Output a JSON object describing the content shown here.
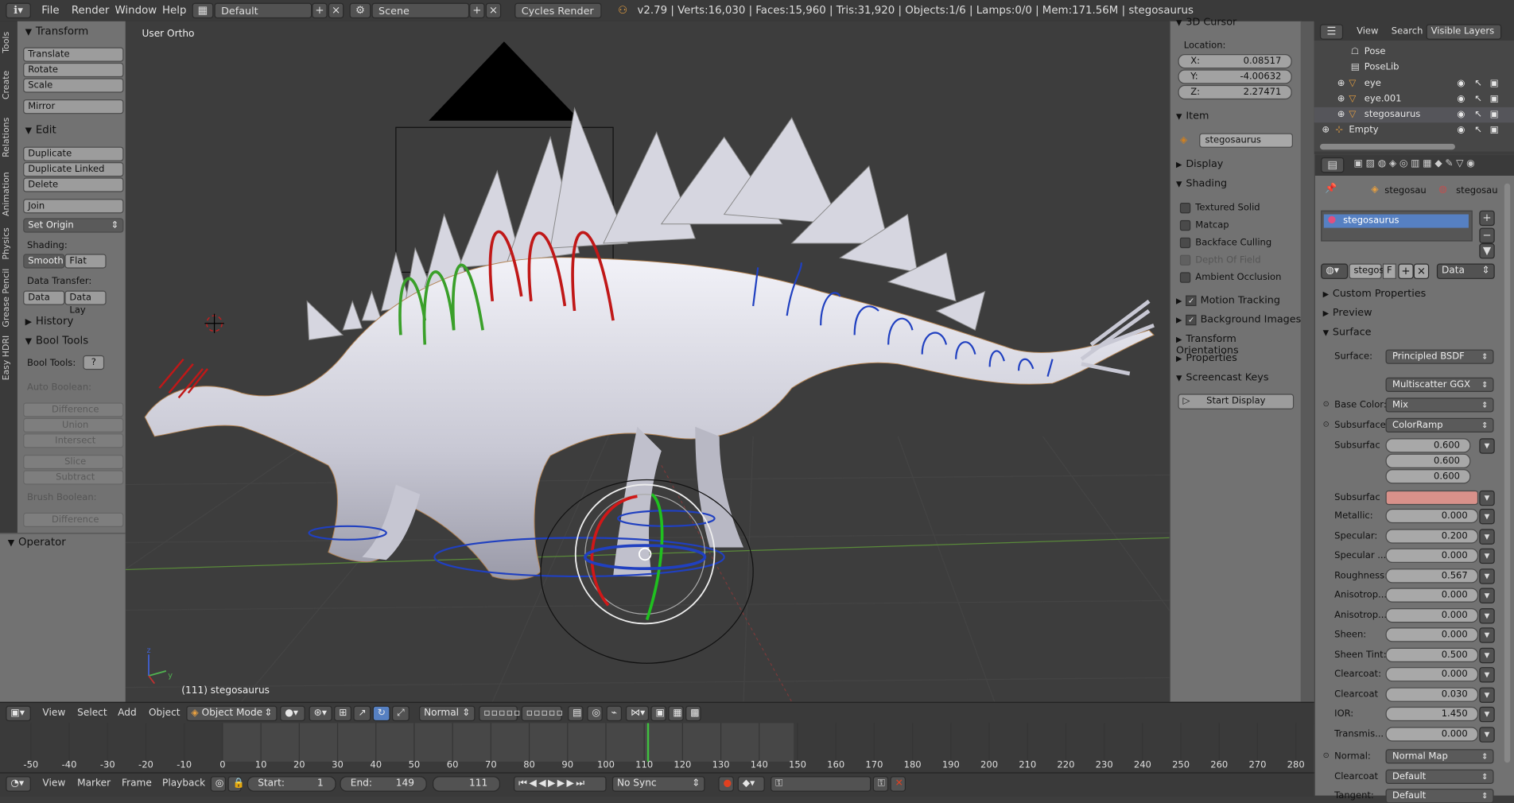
{
  "topbar": {
    "menus": [
      "File",
      "Render",
      "Window",
      "Help"
    ],
    "layout_field": "Default",
    "scene_field": "Scene",
    "render_engine": "Cycles Render",
    "stats": "v2.79 | Verts:16,030 | Faces:15,960 | Tris:31,920 | Objects:1/6 | Lamps:0/0 | Mem:171.56M | stegosaurus"
  },
  "vtabs": [
    "Tools",
    "Create",
    "Relations",
    "Animation",
    "Physics",
    "Grease Pencil",
    "Easy HDRI"
  ],
  "tools": {
    "transform_header": "Transform",
    "translate": "Translate",
    "rotate": "Rotate",
    "scale": "Scale",
    "mirror": "Mirror",
    "edit_header": "Edit",
    "duplicate": "Duplicate",
    "duplicate_linked": "Duplicate Linked",
    "delete": "Delete",
    "join": "Join",
    "set_origin": "Set Origin",
    "shading_label": "Shading:",
    "smooth": "Smooth",
    "flat": "Flat",
    "data_transfer_label": "Data Transfer:",
    "data": "Data",
    "data_lay": "Data Lay",
    "history_header": "History",
    "bool_header": "Bool Tools",
    "bool_tools_label": "Bool Tools:",
    "help_btn": "?",
    "auto_boolean": "Auto Boolean:",
    "difference": "Difference",
    "union": "Union",
    "intersect": "Intersect",
    "slice": "Slice",
    "subtract": "Subtract",
    "brush_boolean": "Brush Boolean:",
    "difference2": "Difference",
    "operator_header": "Operator"
  },
  "viewport": {
    "view_label": "User Ortho",
    "object_label": "(111) stegosaurus",
    "axis_z": "z",
    "axis_y": "y"
  },
  "npanel": {
    "cursor_header": "3D Cursor",
    "location_label": "Location:",
    "x_label": "X:",
    "x_value": "0.08517",
    "y_label": "Y:",
    "y_value": "-4.00632",
    "z_label": "Z:",
    "z_value": "2.27471",
    "item_header": "Item",
    "item_name": "stegosaurus",
    "display_header": "Display",
    "shading_header": "Shading",
    "textured_solid": "Textured Solid",
    "matcap": "Matcap",
    "backface_culling": "Backface Culling",
    "depth_of_field": "Depth Of Field",
    "ambient_occlusion": "Ambient Occlusion",
    "motion_tracking": "Motion Tracking",
    "background_images": "Background Images",
    "transform_orientations": "Transform Orientations",
    "properties": "Properties",
    "screencast_keys": "Screencast Keys",
    "start_display": "Start Display"
  },
  "outliner": {
    "view": "View",
    "search": "Search",
    "visible_layers": "Visible Layers",
    "rows": [
      "Pose",
      "PoseLib",
      "eye",
      "eye.001",
      "stegosaurus",
      "Empty"
    ]
  },
  "props": {
    "breadcrumb_1": "stegosau",
    "breadcrumb_2": "stegosau",
    "material_slot": "stegosaurus",
    "mat_name": "stegos",
    "mat_f": "F",
    "data_dropdown": "Data",
    "custom_properties": "Custom Properties",
    "preview": "Preview",
    "surface_header": "Surface",
    "surface_label": "Surface:",
    "surface_value": "Principled BSDF",
    "distribution": "Multiscatter GGX",
    "base_color_label": "Base Color:",
    "base_color_value": "Mix",
    "subsurface_label": "Subsurface:",
    "subsurface_value": "ColorRamp",
    "subsurface_radius_label": "Subsurfac",
    "subsurface_radius": [
      "0.600",
      "0.600",
      "0.600"
    ],
    "subsurface_color_label": "Subsurfac",
    "subsurface_color": "#d9918a",
    "rows": [
      {
        "label": "Metallic:",
        "value": "0.000"
      },
      {
        "label": "Specular:",
        "value": "0.200"
      },
      {
        "label": "Specular ...",
        "value": "0.000"
      },
      {
        "label": "Roughness:",
        "value": "0.567"
      },
      {
        "label": "Anisotrop...",
        "value": "0.000"
      },
      {
        "label": "Anisotrop...",
        "value": "0.000"
      },
      {
        "label": "Sheen:",
        "value": "0.000"
      },
      {
        "label": "Sheen Tint:",
        "value": "0.500"
      },
      {
        "label": "Clearcoat:",
        "value": "0.000"
      },
      {
        "label": "Clearcoat",
        "value": "0.030"
      },
      {
        "label": "IOR:",
        "value": "1.450"
      },
      {
        "label": "Transmis...",
        "value": "0.000"
      }
    ],
    "normal_label": "Normal:",
    "normal_value": "Normal Map",
    "clearcoat_normal_label": "Clearcoat",
    "clearcoat_normal_value": "Default",
    "tangent_label": "Tangent:",
    "tangent_value": "Default"
  },
  "view_header": {
    "view": "View",
    "select": "Select",
    "add": "Add",
    "object": "Object",
    "mode": "Object Mode",
    "orientation": "Normal"
  },
  "timeline": {
    "ticks": [
      "-50",
      "-40",
      "-30",
      "-20",
      "-10",
      "0",
      "10",
      "20",
      "30",
      "40",
      "50",
      "60",
      "70",
      "80",
      "90",
      "100",
      "110",
      "120",
      "130",
      "140",
      "150",
      "160",
      "170",
      "180",
      "190",
      "200",
      "210",
      "220",
      "230",
      "240",
      "250",
      "260",
      "270",
      "280"
    ],
    "current_frame": 111,
    "range_start": 0,
    "range_end": 149
  },
  "tl_header": {
    "view": "View",
    "marker": "Marker",
    "frame": "Frame",
    "playback": "Playback",
    "start": "Start:",
    "start_value": "1",
    "end": "End:",
    "end_value": "149",
    "current": "111",
    "sync": "No Sync"
  },
  "colors": {
    "spine_green": "#3aa02a",
    "spine_red": "#c01818",
    "spine_blue": "#2040c0",
    "selection_blue": "#5680c2",
    "frame_marker": "#40c040"
  }
}
